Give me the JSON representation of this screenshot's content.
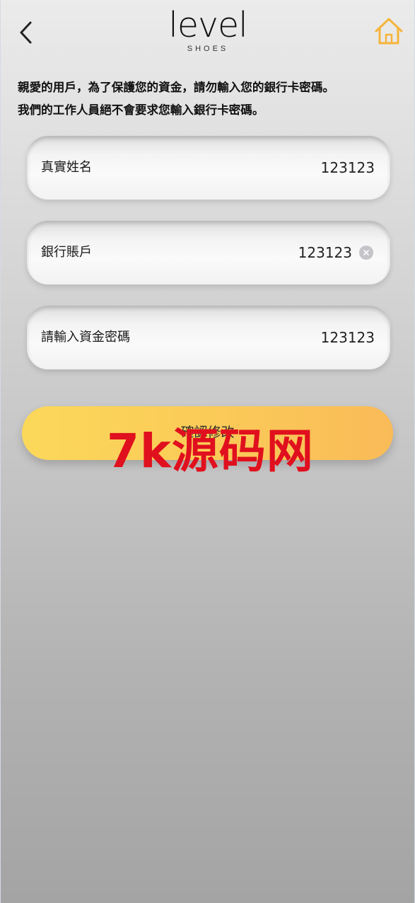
{
  "header": {
    "brand_main": "level",
    "brand_sub": "SHOES"
  },
  "notice": {
    "line1": "親愛的用戶，為了保護您的資金，請勿輸入您的銀行卡密碼。",
    "line2": "我們的工作人員絕不會要求您輸入銀行卡密碼。"
  },
  "form": {
    "real_name": {
      "label": "真實姓名",
      "value": "123123"
    },
    "bank_account": {
      "label": "銀行賬戶",
      "value": "123123"
    },
    "fund_password": {
      "label": "請輸入資金密碼",
      "value": "123123"
    }
  },
  "submit": {
    "label": "確認修改"
  },
  "watermark": {
    "text": "7k源码网"
  },
  "colors": {
    "button_gradient_start": "#fbd85a",
    "button_gradient_end": "#f9bb58",
    "home_icon": "#f5b43c",
    "watermark": "#e0101e"
  }
}
